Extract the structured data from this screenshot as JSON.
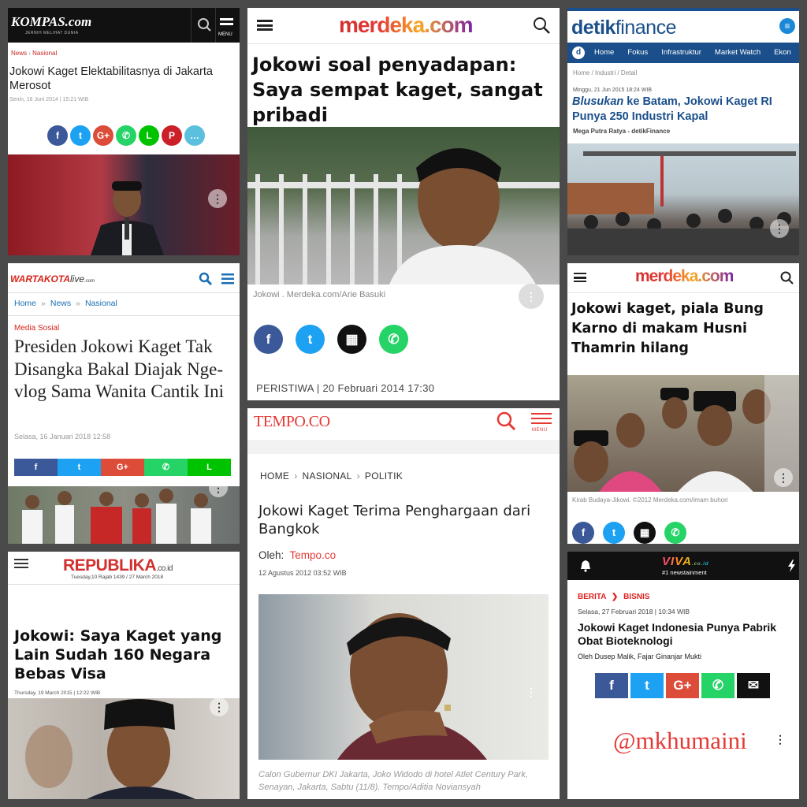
{
  "colors": {
    "kompas_red": "#c62828",
    "merdeka_red": "#d32f2f",
    "detik_blue": "#1a4f8b",
    "wk_red": "#d6261c",
    "tempo_red": "#e53935",
    "viva_red": "#e02020",
    "republika_red": "#d32f2f"
  },
  "kompas": {
    "logo": "KOMPAS.com",
    "tagline": "JERNIH MELIHAT DUNIA",
    "menu": "MENU",
    "crumb1": "News",
    "crumb2": "Nasional",
    "title": "Jokowi Kaget Elektabilitasnya di Jakarta Merosot",
    "date": "Senin, 16 Juni 2014 | 15:21 WIB",
    "share": [
      {
        "icon": "facebook-icon",
        "glyph": "f",
        "color": "#3b5998"
      },
      {
        "icon": "twitter-icon",
        "glyph": "t",
        "color": "#1da1f2"
      },
      {
        "icon": "google-plus-icon",
        "glyph": "G+",
        "color": "#dd4b39"
      },
      {
        "icon": "whatsapp-icon",
        "glyph": "✆",
        "color": "#25d366"
      },
      {
        "icon": "line-icon",
        "glyph": "L",
        "color": "#00c300"
      },
      {
        "icon": "pinterest-icon",
        "glyph": "P",
        "color": "#cb2027"
      },
      {
        "icon": "comment-icon",
        "glyph": "…",
        "color": "#5bc0de"
      }
    ]
  },
  "merdeka1": {
    "logo": "merdeka.com",
    "title": "Jokowi soal penyadapan: Saya sempat kaget, sangat pribadi",
    "caption": "Jokowi . Merdeka.com/Arie Basuki",
    "meta": "PERISTIWA | 20 Februari 2014 17:30",
    "share": [
      {
        "icon": "facebook-icon",
        "glyph": "f",
        "color": "#3b5998"
      },
      {
        "icon": "twitter-icon",
        "glyph": "t",
        "color": "#1da1f2"
      },
      {
        "icon": "bbm-icon",
        "glyph": "▦",
        "color": "#111111"
      },
      {
        "icon": "whatsapp-icon",
        "glyph": "✆",
        "color": "#25d366"
      }
    ]
  },
  "detik": {
    "logo_a": "detik",
    "logo_b": "finance",
    "nav": [
      "Home",
      "Fokus",
      "Infrastruktur",
      "Market Watch",
      "Ekon"
    ],
    "crumb": "Home / Industri / Detail",
    "date": "Minggu, 21 Jun 2015 18:24 WIB",
    "title_em": "Blusukan",
    "title_rest": " ke Batam, Jokowi Kaget RI Punya 250 Industri Kapal",
    "author": "Mega Putra Ratya - detikFinance"
  },
  "wartakota": {
    "logo_a": "WARTAKOTA",
    "logo_b": "live",
    "logo_c": ".com",
    "crumb": [
      "Home",
      "»",
      "News",
      "»",
      "Nasional"
    ],
    "section": "Media Sosial",
    "title": "Presiden Jokowi Kaget Tak Disangka Bakal Diajak Nge-vlog Sama Wanita Cantik Ini",
    "date": "Selasa, 16 Januari 2018 12:58",
    "share": [
      {
        "icon": "facebook-icon",
        "glyph": "f",
        "color": "#3b5998"
      },
      {
        "icon": "twitter-icon",
        "glyph": "t",
        "color": "#1da1f2"
      },
      {
        "icon": "google-plus-icon",
        "glyph": "G+",
        "color": "#dd4b39"
      },
      {
        "icon": "whatsapp-icon",
        "glyph": "✆",
        "color": "#25d366"
      },
      {
        "icon": "line-icon",
        "glyph": "L",
        "color": "#00c300"
      }
    ]
  },
  "merdeka2": {
    "logo": "merdeka.com",
    "title": "Jokowi kaget, piala Bung Karno di makam Husni Thamrin hilang",
    "caption": "Kirab Budaya-Jikowi. ©2012 Merdeka.com/imam buhori",
    "share": [
      {
        "icon": "facebook-icon",
        "glyph": "f",
        "color": "#3b5998"
      },
      {
        "icon": "twitter-icon",
        "glyph": "t",
        "color": "#1da1f2"
      },
      {
        "icon": "bbm-icon",
        "glyph": "▦",
        "color": "#111111"
      },
      {
        "icon": "whatsapp-icon",
        "glyph": "✆",
        "color": "#25d366"
      }
    ]
  },
  "tempo": {
    "logo": "TEMPO.CO",
    "menu": "MENU",
    "crumb": [
      "HOME",
      "NASIONAL",
      "POLITIK"
    ],
    "title": "Jokowi Kaget Terima Penghargaan dari Bangkok",
    "by_label": "Oleh:",
    "by": "Tempo.co",
    "date": "12 Agustus 2012 03:52 WIB",
    "caption": "Calon Gubernur DKI Jakarta, Joko Widodo di hotel Atlet Century Park, Senayan, Jakarta, Sabtu (11/8). Tempo/Aditia Noviansyah"
  },
  "republika": {
    "logo": "REPUBLIKA",
    "logo_b": ".co.id",
    "date_line": "Tuesday,10 Rajab 1439 / 27 March 2018",
    "title": "Jokowi: Saya Kaget yang Lain Sudah 160 Negara Bebas Visa",
    "date": "Thursday, 19 March 2015 | 12:22 WIB"
  },
  "viva": {
    "logo": "VIVA",
    "logo_b": ".co.id",
    "tagline": "#1 newstainment",
    "crumb1": "BERITA",
    "crumb2": "BISNIS",
    "date": "Selasa, 27 Februari 2018 | 10:34 WIB",
    "title": "Jokowi Kaget Indonesia Punya Pabrik Obat Bioteknologi",
    "by": "Oleh  Dusep Malik, Fajar Ginanjar Mukti",
    "share": [
      {
        "icon": "facebook-icon",
        "glyph": "f",
        "color": "#3b5998"
      },
      {
        "icon": "twitter-icon",
        "glyph": "t",
        "color": "#1da1f2"
      },
      {
        "icon": "google-plus-icon",
        "glyph": "G+",
        "color": "#dd4b39"
      },
      {
        "icon": "whatsapp-icon",
        "glyph": "✆",
        "color": "#25d366"
      },
      {
        "icon": "email-icon",
        "glyph": "✉",
        "color": "#111111"
      }
    ]
  },
  "watermark": "@mkhumaini"
}
